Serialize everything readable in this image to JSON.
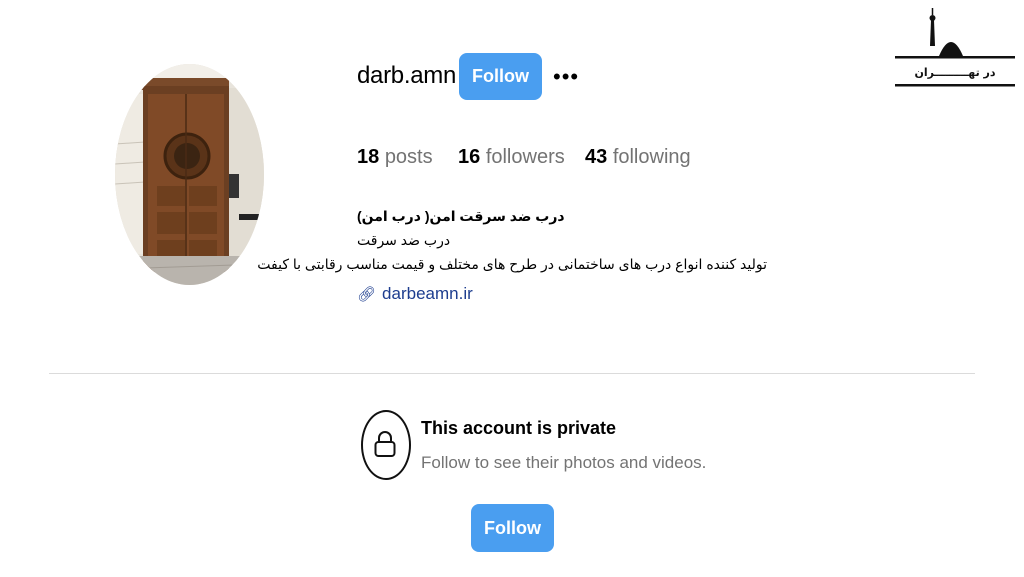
{
  "profile": {
    "username": "darb.amn",
    "follow_label": "Follow",
    "more_label": "•••",
    "stats": {
      "posts_count": "18",
      "posts_label": "posts",
      "followers_count": "16",
      "followers_label": "followers",
      "following_count": "43",
      "following_label": "following"
    },
    "bio": {
      "name": "درب ضد سرقت امن( درب امن)",
      "category": "درب ضد سرقت",
      "description": "تولید کننده انواع درب های ساختمانی در طرح های مختلف و قیمت مناسب رقابتی با کیفت",
      "link": "darbeamn.ir"
    }
  },
  "private": {
    "title": "This account is private",
    "subtitle": "Follow to see their photos and videos.",
    "follow_label": "Follow"
  },
  "logo": {
    "text": "در تهـــــــــران"
  },
  "colors": {
    "button": "#4a9ef0",
    "link": "#1d3d8f",
    "muted": "#737373",
    "divider": "#dbdbdb"
  }
}
